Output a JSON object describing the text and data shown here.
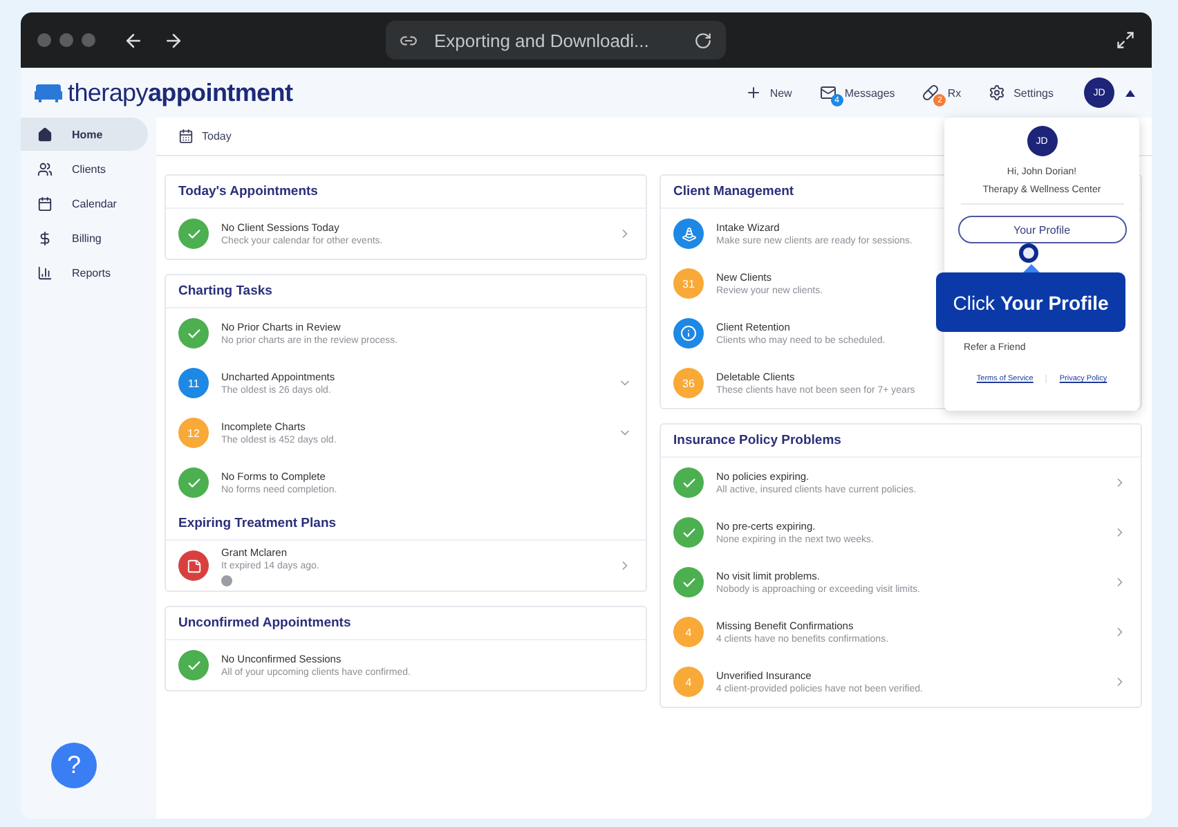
{
  "browser": {
    "address": "Exporting and Downloadi..."
  },
  "logo": {
    "light": "therapy",
    "bold": "appointment"
  },
  "header_actions": [
    {
      "kind": "new",
      "label": "New"
    },
    {
      "kind": "messages",
      "label": "Messages",
      "badge": "4",
      "color": "#1e88e5"
    },
    {
      "kind": "rx",
      "label": "Rx",
      "badge": "2",
      "color": "#f57c3a"
    },
    {
      "kind": "settings",
      "label": "Settings"
    }
  ],
  "user": {
    "initials": "JD",
    "menu_expanded": true
  },
  "sidebar": {
    "items": [
      {
        "label": "Home",
        "selected": true
      },
      {
        "label": "Clients",
        "selected": false
      },
      {
        "label": "Calendar",
        "selected": false
      },
      {
        "label": "Billing",
        "selected": false
      },
      {
        "label": "Reports",
        "selected": false
      }
    ]
  },
  "toolbar": {
    "label": "Today"
  },
  "columns": [
    [
      {
        "sections": [
          {
            "title": "Today's Appointments",
            "rows": [
              {
                "kind": "check",
                "title": "No Client Sessions Today",
                "subtitle": "Check your calendar for other events.",
                "opens": true
              }
            ]
          }
        ]
      },
      {
        "sections": [
          {
            "title": "Charting Tasks",
            "rows": [
              {
                "kind": "check",
                "title": "No Prior Charts in Review",
                "subtitle": "No prior charts are in the review process."
              },
              {
                "kind": "count",
                "value": "11",
                "color": "#1e88e5",
                "title": "Uncharted Appointments",
                "subtitle": "The oldest is 26 days old.",
                "expandable": true
              },
              {
                "kind": "count",
                "value": "12",
                "color": "#f8a937",
                "title": "Incomplete Charts",
                "subtitle": "The oldest is 452 days old.",
                "expandable": true
              },
              {
                "kind": "check",
                "title": "No Forms to Complete",
                "subtitle": "No forms need completion."
              }
            ]
          },
          {
            "title": "Expiring Treatment Plans",
            "rows": [
              {
                "kind": "expired",
                "title": "Grant Mclaren",
                "subtitle": "It expired 14 days ago.",
                "info": true,
                "opens": true
              }
            ]
          }
        ]
      },
      {
        "sections": [
          {
            "title": "Unconfirmed Appointments",
            "rows": [
              {
                "kind": "check",
                "title": "No Unconfirmed Sessions",
                "subtitle": "All of your upcoming clients have confirmed."
              }
            ]
          }
        ]
      }
    ],
    [
      {
        "sections": [
          {
            "title": "Client Management",
            "rows": [
              {
                "kind": "wizard",
                "title": "Intake Wizard",
                "subtitle": "Make sure new clients are ready for sessions."
              },
              {
                "kind": "count",
                "value": "31",
                "color": "#f8a937",
                "title": "New Clients",
                "subtitle": "Review your new clients."
              },
              {
                "kind": "info",
                "title": "Client Retention",
                "subtitle": "Clients who may need to be scheduled."
              },
              {
                "kind": "count",
                "value": "36",
                "color": "#f8a937",
                "title": "Deletable Clients",
                "subtitle": "These clients have not been seen for 7+ years"
              }
            ]
          }
        ]
      },
      {
        "sections": [
          {
            "title": "Insurance Policy Problems",
            "rows": [
              {
                "kind": "check",
                "title": "No policies expiring.",
                "subtitle": "All active, insured clients have current policies.",
                "opens": true
              },
              {
                "kind": "check",
                "title": "No pre-certs expiring.",
                "subtitle": "None expiring in the next two weeks.",
                "opens": true
              },
              {
                "kind": "check",
                "title": "No visit limit problems.",
                "subtitle": "Nobody is approaching or exceeding visit limits.",
                "opens": true
              },
              {
                "kind": "count",
                "value": "4",
                "color": "#f8a937",
                "title": "Missing Benefit Confirmations",
                "subtitle": "4 clients have no benefits confirmations.",
                "opens": true
              },
              {
                "kind": "count",
                "value": "4",
                "color": "#f8a937",
                "title": "Unverified Insurance",
                "subtitle": "4 client-provided policies have not been verified.",
                "opens": true
              }
            ]
          }
        ]
      }
    ]
  ],
  "profile_menu": {
    "initials": "JD",
    "greeting": "Hi, John Dorian!",
    "practice": "Therapy & Wellness Center",
    "button": "Your Profile",
    "items": [
      "Refer a Friend"
    ],
    "links": [
      "Terms of Service",
      "Privacy Policy"
    ]
  },
  "coach": {
    "text": "Click **Your Profile**"
  },
  "help": {
    "label": "?"
  }
}
